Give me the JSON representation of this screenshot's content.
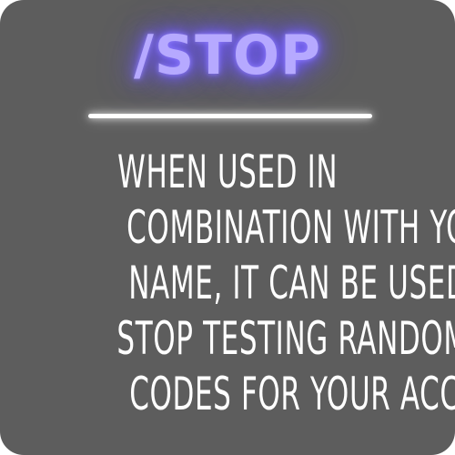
{
  "title": "/STOP",
  "description_lines": [
    "WHEN USED IN",
    "COMBINATION WITH YOUR",
    "NAME, IT CAN BE USED TO",
    "STOP TESTING RANDOM",
    "CODES FOR YOUR ACCOUT"
  ],
  "colors": {
    "background": "#5d5d5d",
    "title": "#b6a9ff",
    "title_glow": "#6a55ff",
    "text": "#ffffff"
  }
}
